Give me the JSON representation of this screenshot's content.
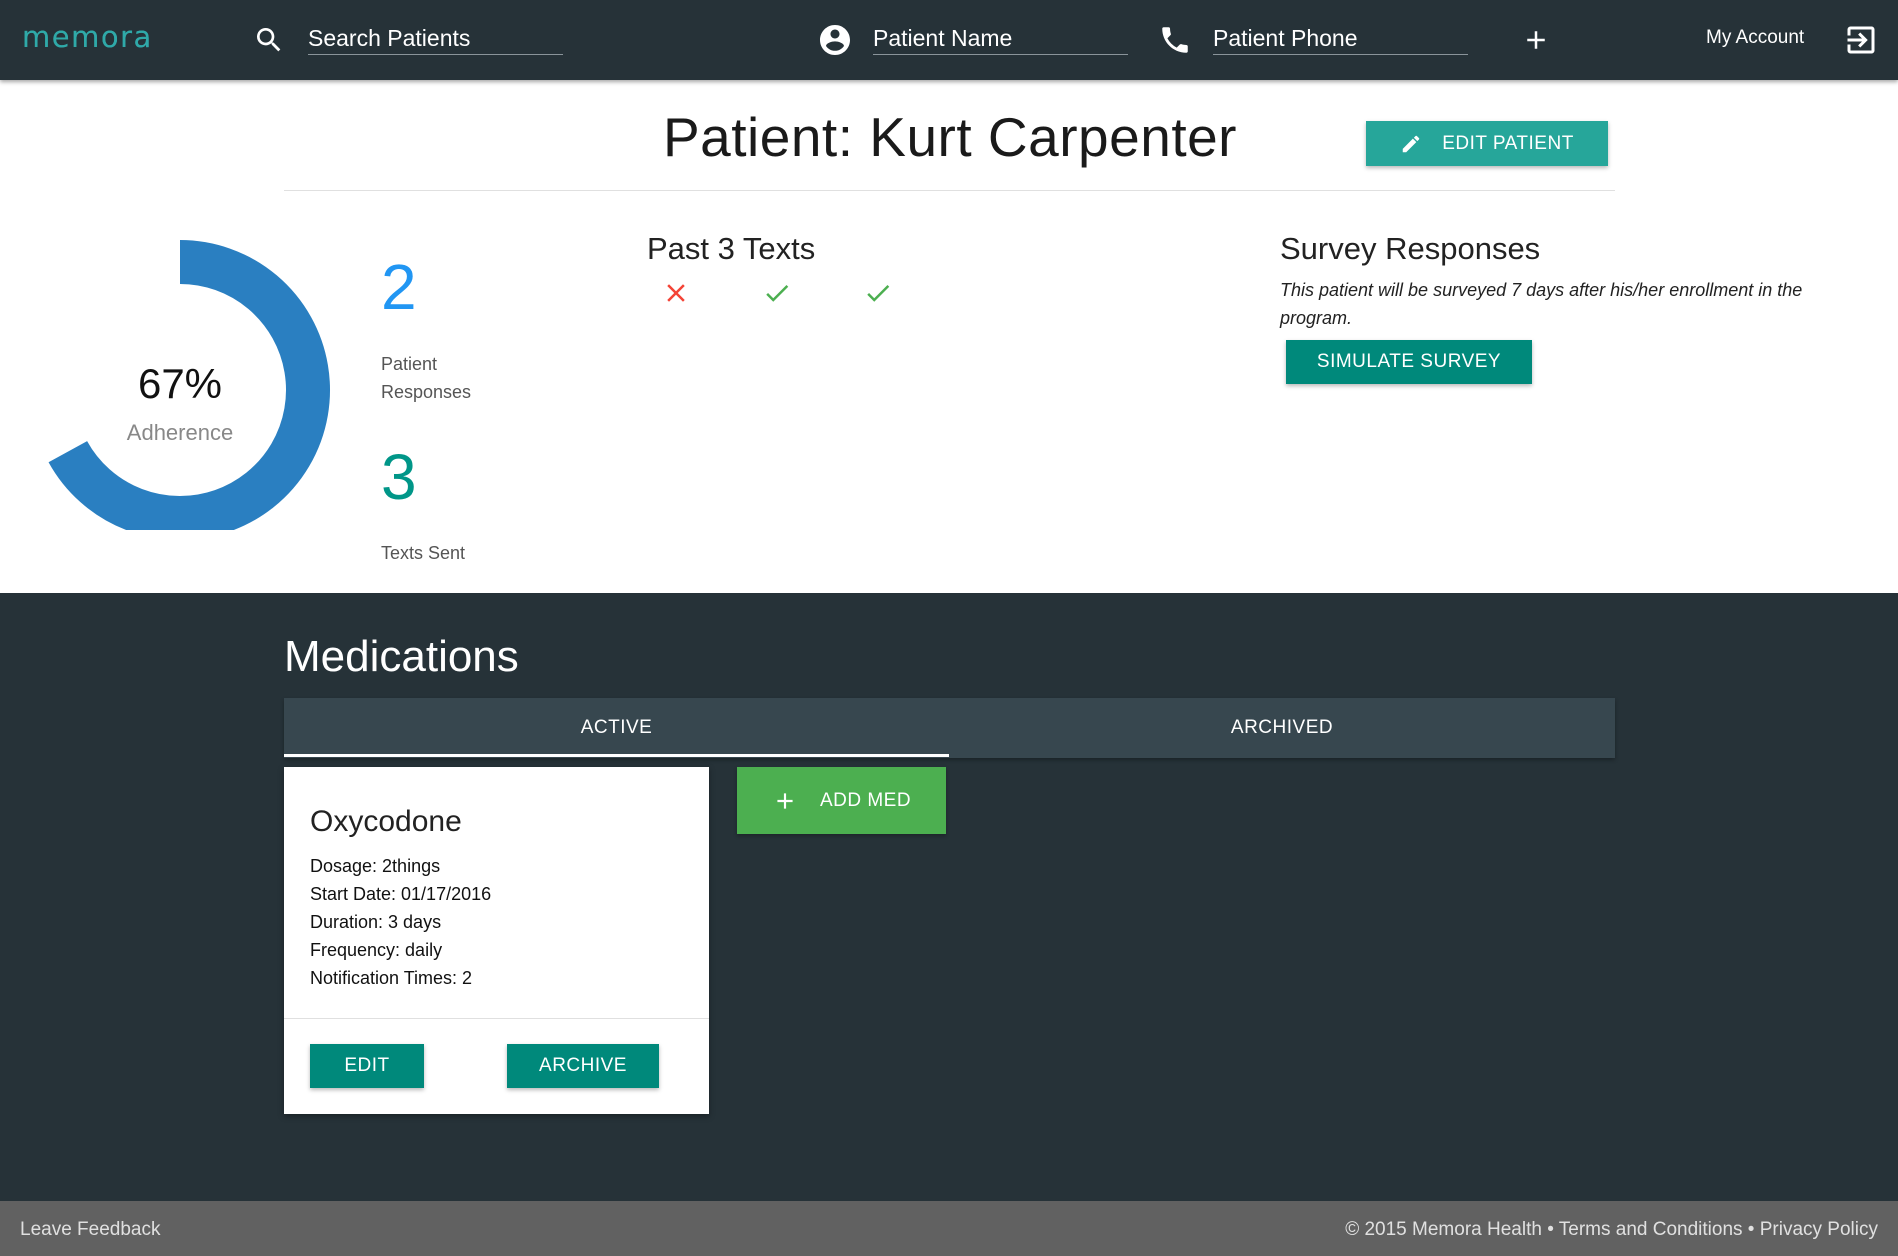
{
  "navbar": {
    "brand": "memora",
    "search_placeholder": "Search Patients",
    "patient_name_placeholder": "Patient Name",
    "patient_phone_placeholder": "Patient Phone",
    "account_label": "My Account",
    "icons": [
      "search-icon",
      "account-circle-icon",
      "phone-icon",
      "plus-icon",
      "logout-icon"
    ]
  },
  "header": {
    "title": "Patient: Kurt Carpenter",
    "edit_button": "EDIT PATIENT"
  },
  "stats": {
    "adherence_pct_label": "67%",
    "adherence_value": 0.67,
    "adherence_label": "Adherence",
    "patient_responses_value": "2",
    "patient_responses_label_1": "Patient",
    "patient_responses_label_2": "Responses",
    "texts_sent_value": "3",
    "texts_sent_label": "Texts Sent"
  },
  "past_texts": {
    "title": "Past 3 Texts",
    "results": [
      "missed",
      "responded",
      "responded"
    ]
  },
  "survey": {
    "title": "Survey Responses",
    "description": "This patient will be surveyed 7 days after his/her enrollment in the program.",
    "button": "SIMULATE SURVEY"
  },
  "medications": {
    "title": "Medications",
    "tabs": [
      {
        "label": "ACTIVE",
        "active": true
      },
      {
        "label": "ARCHIVED",
        "active": false
      }
    ],
    "add_button": "ADD MED",
    "cards": [
      {
        "name": "Oxycodone",
        "lines": [
          "Dosage: 2things",
          "Start Date: 01/17/2016",
          "Duration: 3 days",
          "Frequency: daily",
          "Notification Times: 2"
        ],
        "edit_button": "EDIT",
        "archive_button": "ARCHIVE"
      }
    ]
  },
  "footer": {
    "left": "Leave Feedback",
    "right": "© 2015 Memora Health • Terms and Conditions • Privacy Policy"
  },
  "colors": {
    "navbar": "#263238",
    "accent_teal": "#26a69a",
    "accent_teal_dark": "#00897b",
    "add_green": "#4caf50",
    "donut_blue": "#2a7fc1",
    "responses_blue": "#2196f3",
    "texts_sent_teal": "#009688",
    "missed_red": "#f44336",
    "responded_green": "#4caf50",
    "footer": "#616161"
  }
}
